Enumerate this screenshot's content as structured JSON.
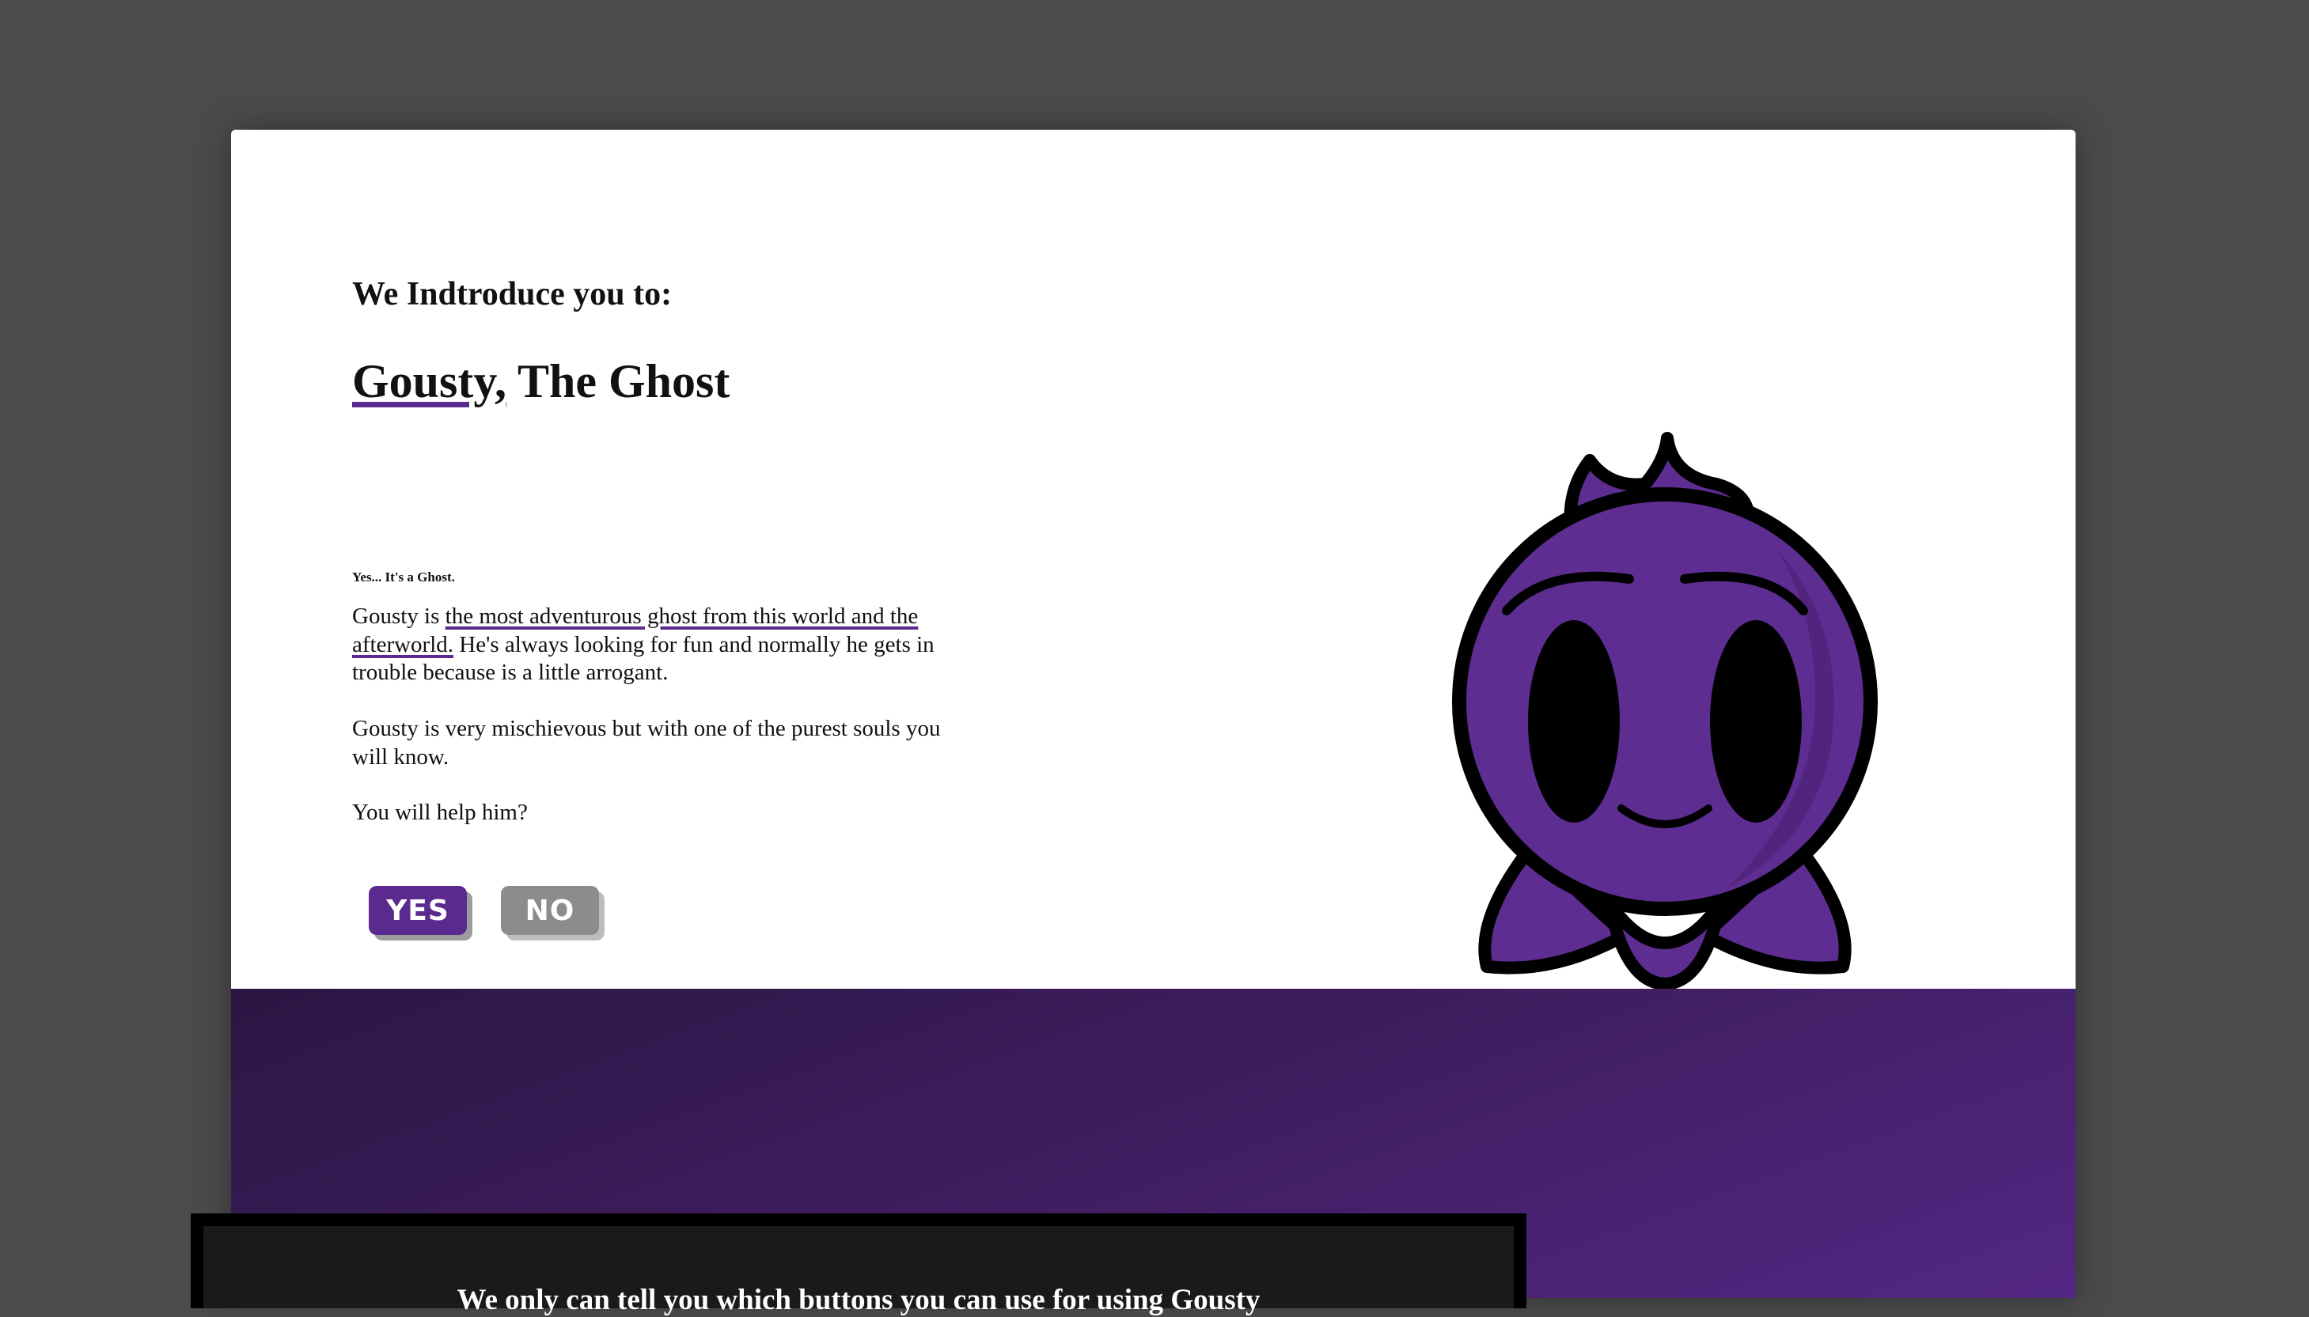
{
  "hero": {
    "intro_heading": "We Indtroduce you to:",
    "title_highlight": "Gousty,",
    "title_rest": " The Ghost",
    "tagline": "Yes... It's a Ghost.",
    "paragraph1_start": "Gousty is ",
    "paragraph1_highlight": "the most adventurous ghost from this world and the afterworld.",
    "paragraph1_end": " He's always looking for fun and normally he gets in trouble because is a little arrogant.",
    "paragraph2": "Gousty is very mischievous but with one of the purest souls you will know.",
    "paragraph3": "You will help him?",
    "yes_label": "YES",
    "no_label": "NO"
  },
  "info_section": {
    "title": "We only can tell you which buttons you can use for using Gousty"
  },
  "colors": {
    "brand_purple": "#5b2a8e",
    "ghost_body": "#5e2d91",
    "band_dark": "#2c1643",
    "band_light": "#532783",
    "page_background": "#4b4b4b"
  },
  "icons": {
    "mascot": "purple-ghost-mascot"
  }
}
